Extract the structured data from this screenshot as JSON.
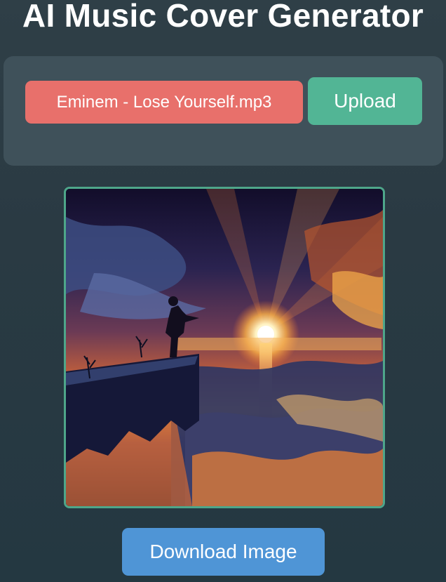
{
  "header": {
    "title": "AI Music Cover Generator"
  },
  "upload": {
    "file_name": "Eminem - Lose Yourself.mp3",
    "upload_label": "Upload"
  },
  "cover": {
    "description_icon": "generated-cover-image"
  },
  "actions": {
    "download_label": "Download Image"
  },
  "colors": {
    "file_pill": "#e8706b",
    "upload_button": "#52b595",
    "download_button": "#4f95d6",
    "frame_border": "#4ea68a",
    "panel": "#3f515a"
  }
}
